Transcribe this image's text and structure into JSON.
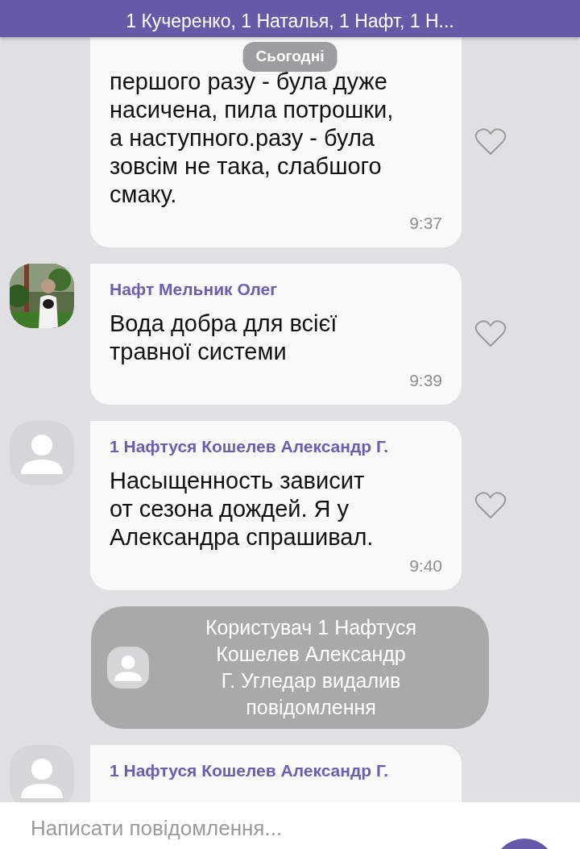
{
  "header": {
    "subtitle": "1 Кучеренко, 1 Наталья, 1 Нафт, 1 Н..."
  },
  "date_pill": "Сьогодні",
  "messages": [
    {
      "kind": "message",
      "lines": [
        "першого разу - була дуже",
        "насичена, пила потрошки,",
        "а  наступного.разу - була",
        "зовсім не така, слабшого",
        "смаку."
      ],
      "time": "9:37"
    },
    {
      "kind": "message",
      "avatar": {
        "photo": true
      },
      "sender": "Нафт Мельник Олег",
      "lines": [
        "Вода добра для всієї",
        "травної системи"
      ],
      "time": "9:39"
    },
    {
      "kind": "message",
      "avatar": {
        "photo": false
      },
      "sender": "1 Нафтуся Кошелев Александр Г.",
      "lines": [
        "Насыщенность зависит",
        "от сезона дождей. Я у",
        "Александра спрашивал."
      ],
      "time": "9:40"
    },
    {
      "kind": "deleted",
      "lines": [
        "Користувач 1 Нафтуся",
        "Кошелев Александр",
        "Г. Угледар видалив",
        "повідомлення"
      ]
    },
    {
      "kind": "message",
      "avatar": {
        "photo": false
      },
      "sender": "1 Нафтуся Кошелев Александр Г."
    }
  ],
  "composer": {
    "placeholder": "Написати повідомлення..."
  }
}
